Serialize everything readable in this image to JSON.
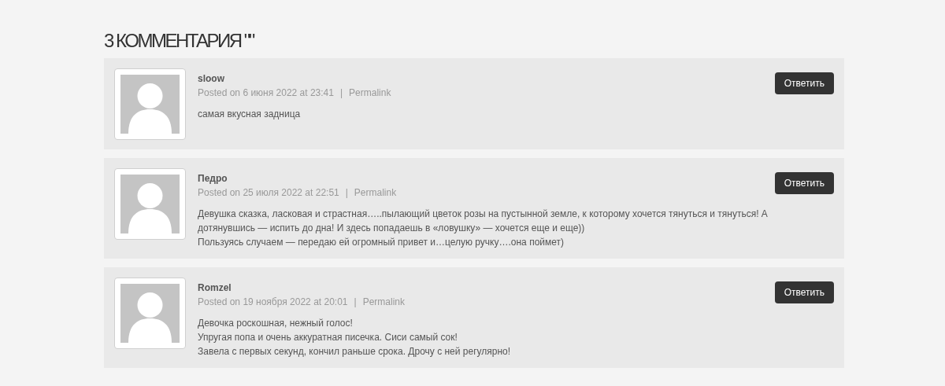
{
  "heading": "3 КОММЕНТАРИЯ \"\"",
  "comments": [
    {
      "author": "sloow",
      "posted": "Posted on 6 июня 2022 at 23:41",
      "separator": "|",
      "permalink": "Permalink",
      "reply": "Ответить",
      "lines": [
        "самая вкусная задница"
      ]
    },
    {
      "author": "Педро",
      "posted": "Posted on 25 июля 2022 at 22:51",
      "separator": "|",
      "permalink": "Permalink",
      "reply": "Ответить",
      "lines": [
        "Девушка сказка, ласковая и страстная…..пылающий цветок розы на пустынной земле, к которому хочется тянуться и тянуться! А дотянувшись — испить до дна! И здесь попадаешь в «ловушку» — хочется еще и еще))",
        "Пользуясь случаем — передаю ей огромный привет и…целую ручку….она поймет)"
      ]
    },
    {
      "author": "Romzel",
      "posted": "Posted on 19 ноября 2022 at 20:01",
      "separator": "|",
      "permalink": "Permalink",
      "reply": "Ответить",
      "lines": [
        "Девочка роскошная, нежный голос!",
        "Упругая попа и очень аккуратная писечка. Сиси самый сок!",
        "Завела с первых секунд, кончил раньше срока. Дрочу с ней регулярно!"
      ]
    }
  ]
}
